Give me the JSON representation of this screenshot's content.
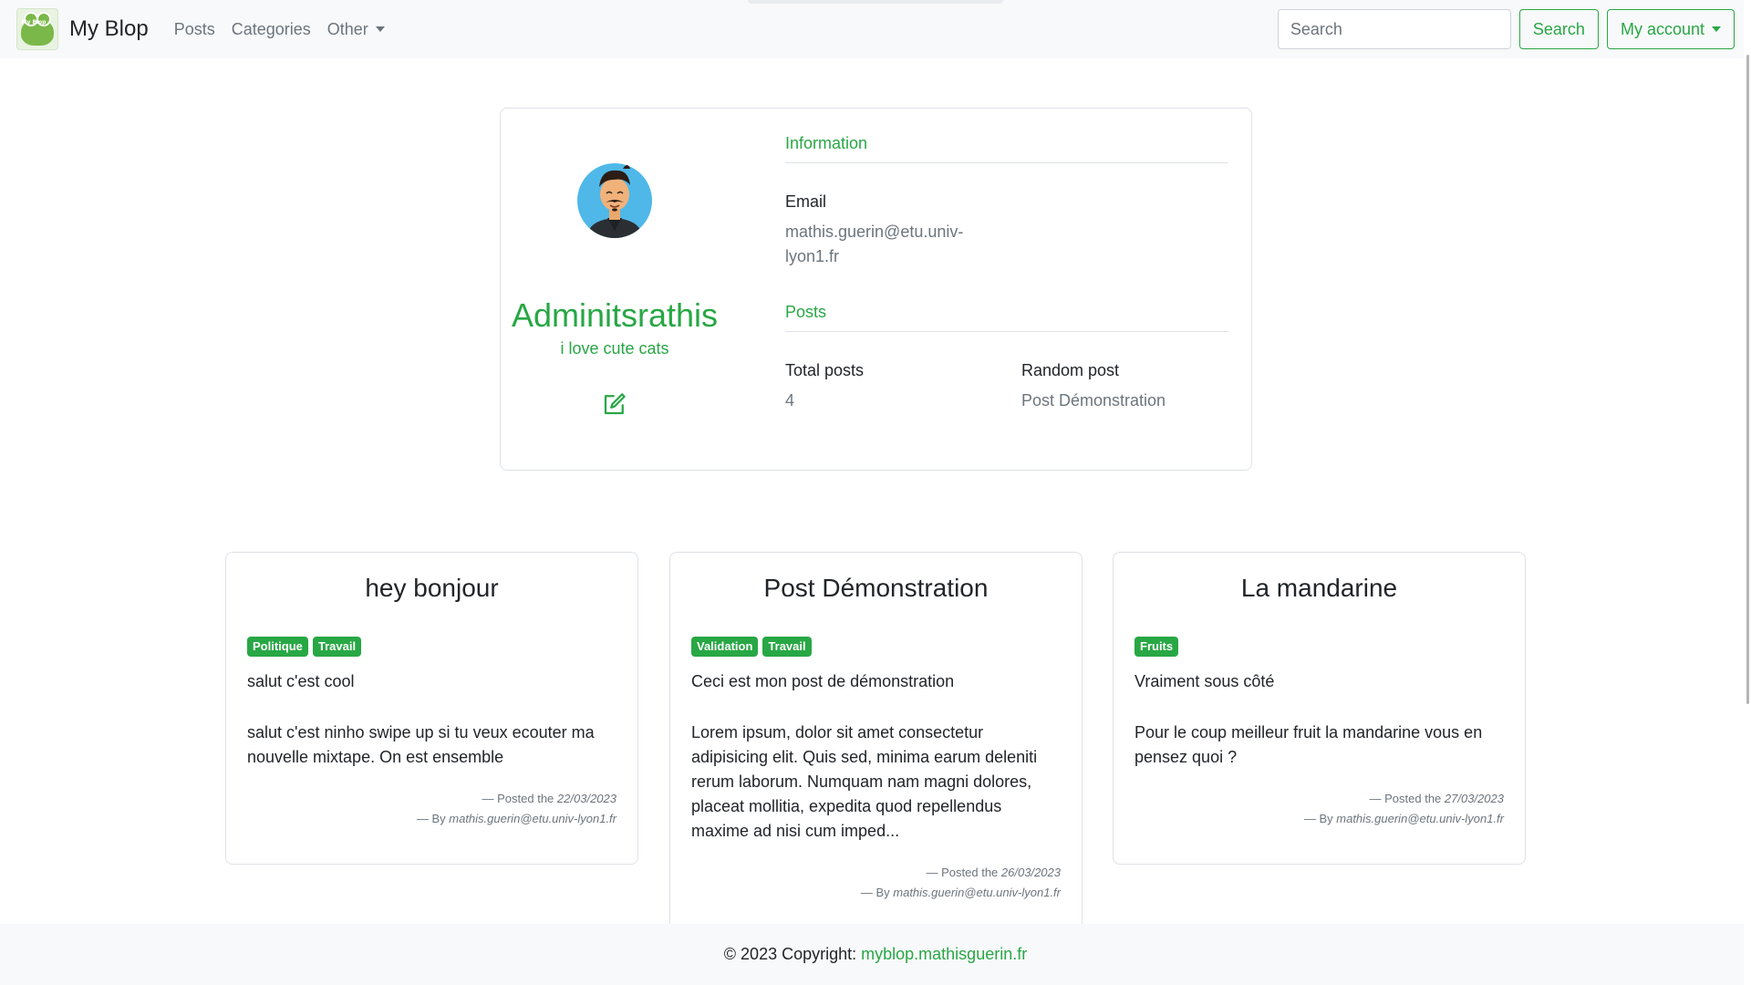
{
  "nav": {
    "brand_logo_text": "My Blop",
    "brand": "My Blop",
    "links": [
      "Posts",
      "Categories"
    ],
    "other": "Other",
    "search_placeholder": "Search",
    "search_button": "Search",
    "account": "My account"
  },
  "profile": {
    "name": "Adminitsrathis",
    "bio": "i love cute cats",
    "information_heading": "Information",
    "email_label": "Email",
    "email_line1": "mathis.guerin@etu.univ-",
    "email_line2": "lyon1.fr",
    "posts_heading": "Posts",
    "total_label": "Total posts",
    "total_value": "4",
    "random_label": "Random post",
    "random_value": "Post Démonstration"
  },
  "posts": [
    {
      "title": "hey bonjour",
      "tags": [
        "Politique",
        "Travail"
      ],
      "subtitle": "salut c'est cool",
      "body": "salut c'est ninho swipe up si tu veux ecouter ma nouvelle mixtape. On est ensemble",
      "posted_prefix": "— Posted the",
      "date": "22/03/2023",
      "by_prefix": "— By",
      "author": "mathis.guerin@etu.univ-lyon1.fr"
    },
    {
      "title": "Post Démonstration",
      "tags": [
        "Validation",
        "Travail"
      ],
      "subtitle": "Ceci est mon post de démonstration",
      "body": "Lorem ipsum, dolor sit amet consectetur adipisicing elit. Quis sed, minima earum deleniti rerum laborum. Numquam nam magni dolores, placeat mollitia, expedita quod repellendus maxime ad nisi cum imped...",
      "posted_prefix": "— Posted the",
      "date": "26/03/2023",
      "by_prefix": "— By",
      "author": "mathis.guerin@etu.univ-lyon1.fr"
    },
    {
      "title": "La mandarine",
      "tags": [
        "Fruits"
      ],
      "subtitle": "Vraiment sous côté",
      "body": "Pour le coup meilleur fruit la mandarine vous en pensez quoi ?",
      "posted_prefix": "— Posted the",
      "date": "27/03/2023",
      "by_prefix": "— By",
      "author": "mathis.guerin@etu.univ-lyon1.fr"
    }
  ],
  "footer": {
    "copyright": "© 2023 Copyright:",
    "link": "myblop.mathisguerin.fr"
  },
  "colors": {
    "accent": "#28a745",
    "muted": "#6c757d",
    "navbar_bg": "#f8f9fa"
  }
}
